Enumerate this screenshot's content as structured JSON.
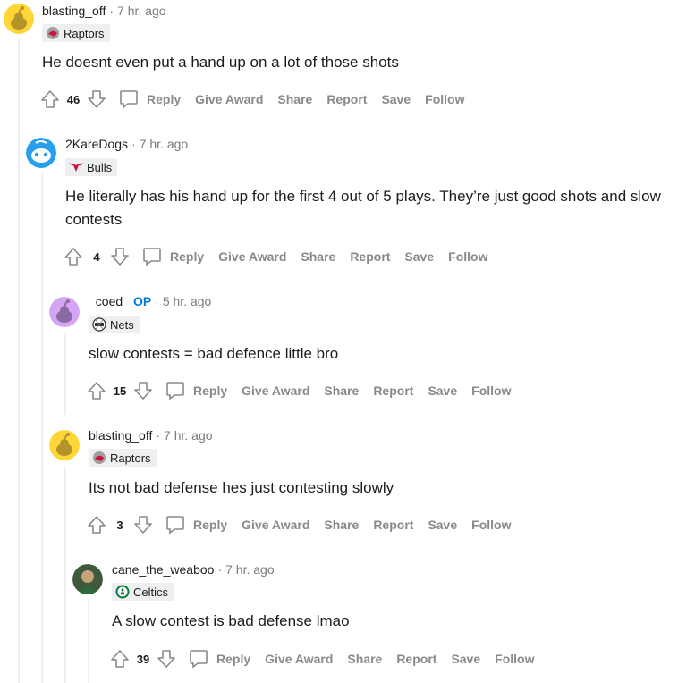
{
  "comments": [
    {
      "username": "blasting_off",
      "op_label": "",
      "time": "7 hr. ago",
      "flair": "Raptors",
      "body": "He doesnt even put a hand up on a lot of those shots",
      "score": "46"
    },
    {
      "username": "2KareDogs",
      "op_label": "",
      "time": "7 hr. ago",
      "flair": "Bulls",
      "body": "He literally has his hand up for the first 4 out of 5 plays. They’re just good shots and slow contests",
      "score": "4"
    },
    {
      "username": "_coed_",
      "op_label": "OP",
      "time": "5 hr. ago",
      "flair": "Nets",
      "body": "slow contests = bad defence little bro",
      "score": "15"
    },
    {
      "username": "blasting_off",
      "op_label": "",
      "time": "7 hr. ago",
      "flair": "Raptors",
      "body": "Its not bad defense hes just contesting slowly",
      "score": "3"
    },
    {
      "username": "cane_the_weaboo",
      "op_label": "",
      "time": "7 hr. ago",
      "flair": "Celtics",
      "body": "A slow contest is bad defense lmao",
      "score": "39"
    }
  ],
  "actions": {
    "reply": "Reply",
    "give_award": "Give Award",
    "share": "Share",
    "report": "Report",
    "save": "Save",
    "follow": "Follow"
  },
  "separator": "·",
  "colors": {
    "op": "#0079d3",
    "meta": "#787c7e",
    "action": "#878a8c",
    "thread": "#edeff1"
  }
}
